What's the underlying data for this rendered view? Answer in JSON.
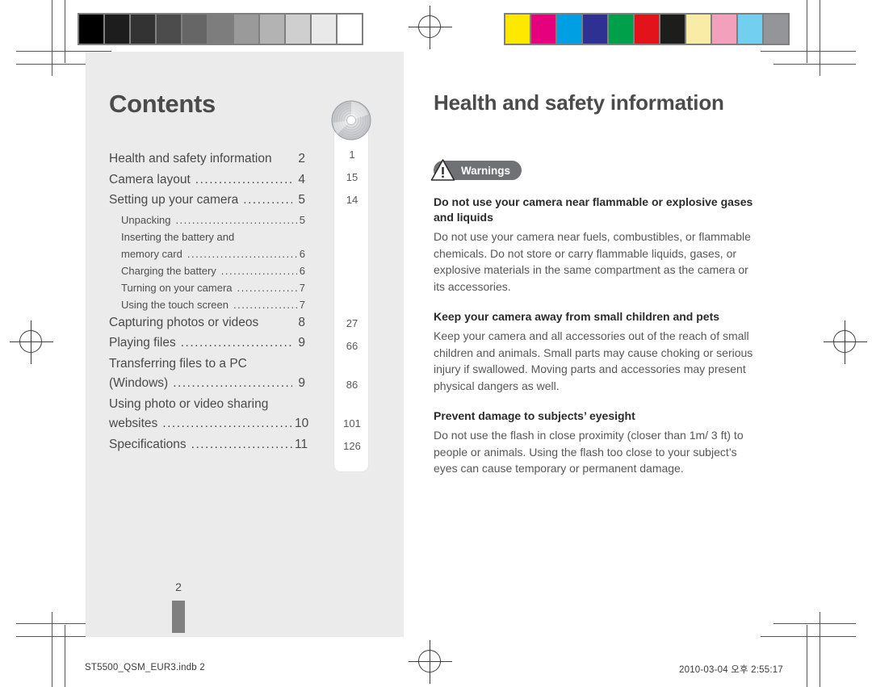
{
  "printmarks": {
    "grayscale_strip": {
      "name": "grayscale-calibration-strip",
      "patches": [
        "#000000",
        "#1d1d1d",
        "#333333",
        "#4c4c4c",
        "#666666",
        "#7d7d7d",
        "#9a9a9a",
        "#b3b3b3",
        "#cfcfcf",
        "#e9e9e9",
        "#ffffff"
      ]
    },
    "color_strip": {
      "name": "color-calibration-strip",
      "patches": [
        "#ffe800",
        "#e6007e",
        "#009fe3",
        "#2e3192",
        "#00a04a",
        "#e3131b",
        "#1d1d1b",
        "#f9eca6",
        "#f3a0bd",
        "#73cff0",
        "#939598"
      ]
    }
  },
  "left_page": {
    "title": "Contents",
    "toc": [
      {
        "level": 1,
        "label": "Health and safety information",
        "dots": false,
        "page": "2"
      },
      {
        "level": 1,
        "label": "Camera layout",
        "dots": true,
        "page": "4"
      },
      {
        "level": 1,
        "label": "Setting up your camera",
        "dots": true,
        "page": "5"
      },
      {
        "level": 2,
        "label": "Unpacking",
        "dots": true,
        "page": "5"
      },
      {
        "level": 2,
        "label": "Inserting the battery and",
        "wrap": "memory card",
        "dots": true,
        "page": "6"
      },
      {
        "level": 2,
        "label": "Charging the battery",
        "dots": true,
        "page": "6"
      },
      {
        "level": 2,
        "label": "Turning on your camera",
        "dots": true,
        "page": "7"
      },
      {
        "level": 2,
        "label": "Using the touch screen",
        "dots": true,
        "page": "7"
      },
      {
        "level": 1,
        "label": "Capturing photos or videos",
        "dots": false,
        "page": "8"
      },
      {
        "level": 1,
        "label": "Playing files",
        "dots": true,
        "page": "9"
      },
      {
        "level": 1,
        "label": "Transferring files to a PC",
        "wrap": "(Windows)",
        "dots": true,
        "page": "9"
      },
      {
        "level": 1,
        "label": "Using photo or video sharing",
        "wrap": "websites",
        "dots": true,
        "page": "10"
      },
      {
        "level": 1,
        "label": "Specifications",
        "dots": true,
        "page": "11"
      }
    ],
    "side_numbers": [
      "1",
      "15",
      "14",
      "27",
      "66",
      "86",
      "101",
      "126"
    ],
    "disc_icon": "cd-disc-icon",
    "page_number": "2"
  },
  "right_page": {
    "title": "Health and safety information",
    "badge": {
      "label": "Warnings",
      "icon": "warning-triangle-icon",
      "bg": "#6f7175"
    },
    "sections": [
      {
        "heading": "Do not use your camera near flammable or explosive gases and liquids",
        "body": "Do not use your camera near fuels, combustibles, or flammable chemicals. Do not store or carry flammable liquids, gases, or explosive materials in the same compartment as the camera or its accessories."
      },
      {
        "heading": "Keep your camera away from small children and pets",
        "body": "Keep your camera and all accessories out of the reach of small children and animals. Small parts may cause choking or serious injury if swallowed. Moving parts and accessories may present physical dangers as well."
      },
      {
        "heading": "Prevent damage to subjects’ eyesight",
        "body": "Do not use the flash in close proximity (closer than 1m/ 3 ft) to people or animals. Using the flash too close to your subject’s eyes can cause temporary or permanent damage."
      }
    ]
  },
  "footer": {
    "left": "ST5500_QSM_EUR3.indb   2",
    "right": "2010-03-04   오후 2:55:17"
  }
}
